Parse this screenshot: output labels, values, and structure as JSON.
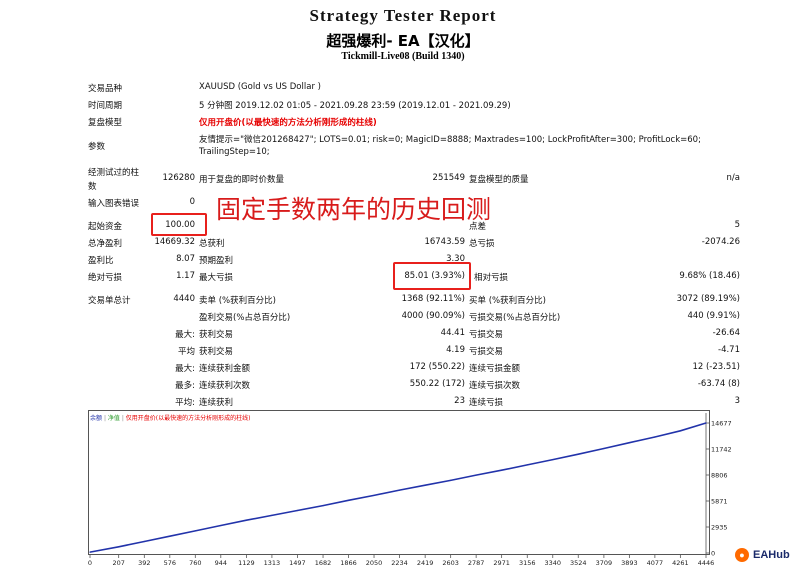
{
  "header": {
    "title": "Strategy Tester Report",
    "ea_name": "超强爆利- EA【汉化】",
    "server": "Tickmill-Live08 (Build 1340)"
  },
  "info": {
    "symbol_label": "交易品种",
    "symbol_value": "XAUUSD (Gold vs US Dollar )",
    "period_label": "时间周期",
    "period_value": "5 分钟图 2019.12.02 01:05 - 2021.09.28 23:59 (2019.12.01 - 2021.09.29)",
    "model_label": "复盘模型",
    "model_value": "仅用开盘价(以最快速的方法分析刚形成的柱线)",
    "params_label": "参数",
    "params_value_1": "友情提示=\"微信201268427\"; LOTS=0.01; risk=0; MagicID=8888; Maxtrades=100; LockProfitAfter=300; ProfitLock=60;",
    "params_value_2": "TrailingStep=10;"
  },
  "stats": {
    "bars_label_1": "经测试过的柱",
    "bars_label_2": "数",
    "bars_value": "126280",
    "ticks_label": "用于复盘的即时价数量",
    "ticks_value": "251549",
    "quality_label": "复盘模型的质量",
    "quality_value": "n/a",
    "mismatch_label": "输入图表错误",
    "mismatch_value": "0",
    "deposit_label": "起始资金",
    "deposit_value": "100.00",
    "spread_label": "点差",
    "spread_value": "5",
    "net_label": "总净盈利",
    "net_value": "14669.32",
    "gross_profit_label": "总获利",
    "gross_profit_value": "16743.59",
    "gross_loss_label": "总亏损",
    "gross_loss_value": "-2074.26",
    "pf_label": "盈利比",
    "pf_value": "8.07",
    "expected_label": "预期盈利",
    "expected_value": "3.30",
    "abs_dd_label": "绝对亏损",
    "abs_dd_value": "1.17",
    "max_dd_label": "最大亏损",
    "max_dd_value": "85.01 (3.93%)",
    "rel_dd_label": "相对亏损",
    "rel_dd_value": "9.68% (18.46)",
    "total_trades_label": "交易单总计",
    "total_trades_value": "4440",
    "short_label": "卖单 (%获利百分比)",
    "short_value": "1368 (92.11%)",
    "long_label": "买单 (%获利百分比)",
    "long_value": "3072 (89.19%)",
    "profit_trades_label": "盈利交易(%占总百分比)",
    "profit_trades_value": "4000 (90.09%)",
    "loss_trades_label": "亏损交易(%占总百分比)",
    "loss_trades_value": "440 (9.91%)",
    "largest_label": "最大:",
    "largest_profit_label": "获利交易",
    "largest_profit_value": "44.41",
    "largest_loss_label": "亏损交易",
    "largest_loss_value": "-26.64",
    "average_label": "平均",
    "avg_profit_label": "获利交易",
    "avg_profit_value": "4.19",
    "avg_loss_label": "亏损交易",
    "avg_loss_value": "-4.71",
    "max_label": "最大:",
    "consec_wins_money_label": "连续获利金额",
    "consec_wins_money_value": "172 (550.22)",
    "consec_losses_money_label": "连续亏损金额",
    "consec_losses_money_value": "12 (-23.51)",
    "maximal_label": "最多:",
    "consec_profit_count_label": "连续获利次数",
    "consec_profit_count_value": "550.22 (172)",
    "consec_loss_count_label": "连续亏损次数",
    "consec_loss_count_value": "-63.74 (8)",
    "avg_consec_label": "平均:",
    "avg_consec_wins_label": "连续获利",
    "avg_consec_wins_value": "23",
    "avg_consec_losses_label": "连续亏损",
    "avg_consec_losses_value": "3"
  },
  "annotation": {
    "text": "固定手数两年的历史回测",
    "color": "#d81b1b"
  },
  "legend": {
    "balance": "余额",
    "equity": "净值",
    "note": "仅用开盘价(以最快速的方法分析刚形成的柱线)"
  },
  "chart_data": {
    "type": "line",
    "line_color": "#2233aa",
    "y_ticks": [
      "14677",
      "11742",
      "8806",
      "5871",
      "2935",
      "0"
    ],
    "x_ticks": [
      "0",
      "207",
      "392",
      "576",
      "760",
      "944",
      "1129",
      "1313",
      "1497",
      "1682",
      "1866",
      "2050",
      "2234",
      "2419",
      "2603",
      "2787",
      "2971",
      "3156",
      "3340",
      "3524",
      "3709",
      "3893",
      "4077",
      "4261",
      "4446"
    ],
    "ylim": [
      0,
      14677
    ],
    "xlim": [
      0,
      4446
    ],
    "series": [
      {
        "name": "余额",
        "x": [
          0,
          207,
          392,
          576,
          760,
          944,
          1129,
          1313,
          1497,
          1682,
          1866,
          2050,
          2234,
          2419,
          2603,
          2787,
          2971,
          3156,
          3340,
          3524,
          3709,
          3893,
          4077,
          4261,
          4446
        ],
        "y": [
          100,
          700,
          1300,
          1900,
          2500,
          3100,
          3700,
          4250,
          4800,
          5350,
          5950,
          6500,
          7100,
          7650,
          8200,
          8800,
          9350,
          9950,
          10550,
          11150,
          11800,
          12450,
          13100,
          13800,
          14677
        ]
      }
    ]
  },
  "branding": {
    "logo_text": "EAHub"
  }
}
